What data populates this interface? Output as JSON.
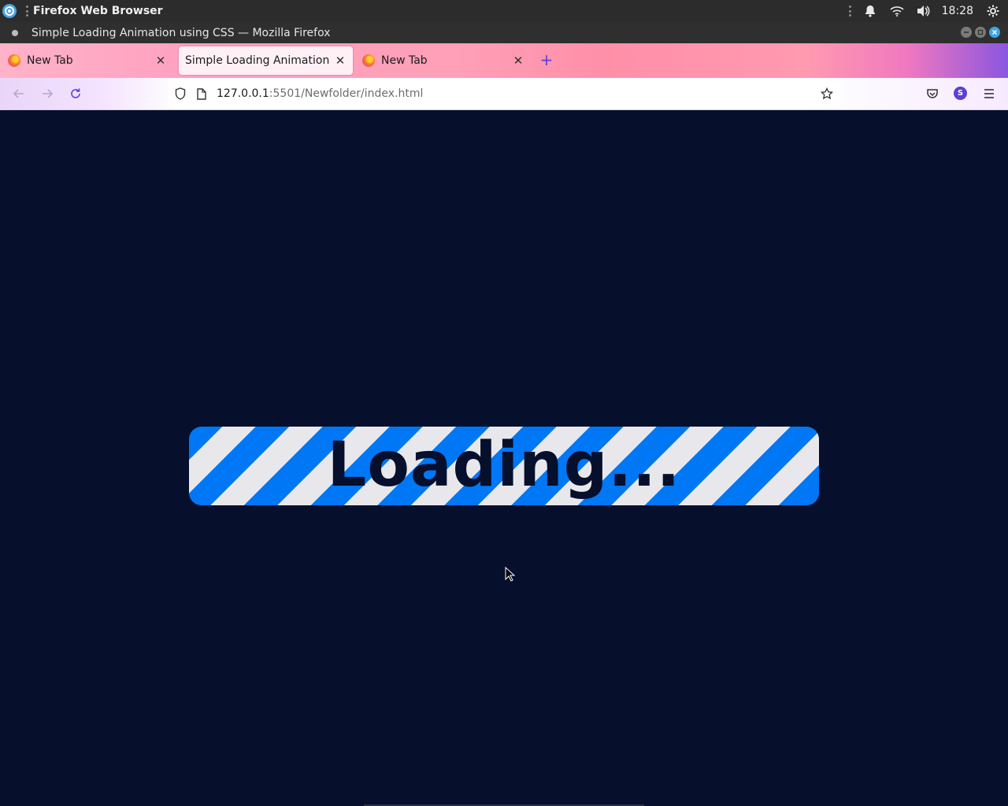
{
  "top_panel": {
    "app_name": "Firefox Web Browser",
    "clock": "18:28"
  },
  "window": {
    "title": "Simple Loading Animation using CSS — Mozilla Firefox"
  },
  "tabs": [
    {
      "label": "New Tab",
      "active": false
    },
    {
      "label": "Simple Loading Animation us",
      "active": true
    },
    {
      "label": "New Tab",
      "active": false
    }
  ],
  "urlbar": {
    "host": "127.0.0.1",
    "path": ":5501/Newfolder/index.html"
  },
  "account": {
    "initial": "S"
  },
  "page": {
    "loading_text": "Loading..."
  },
  "colors": {
    "page_bg": "#060f2c",
    "stripe_blue": "#0077f5",
    "stripe_light": "#e8e8ec"
  }
}
